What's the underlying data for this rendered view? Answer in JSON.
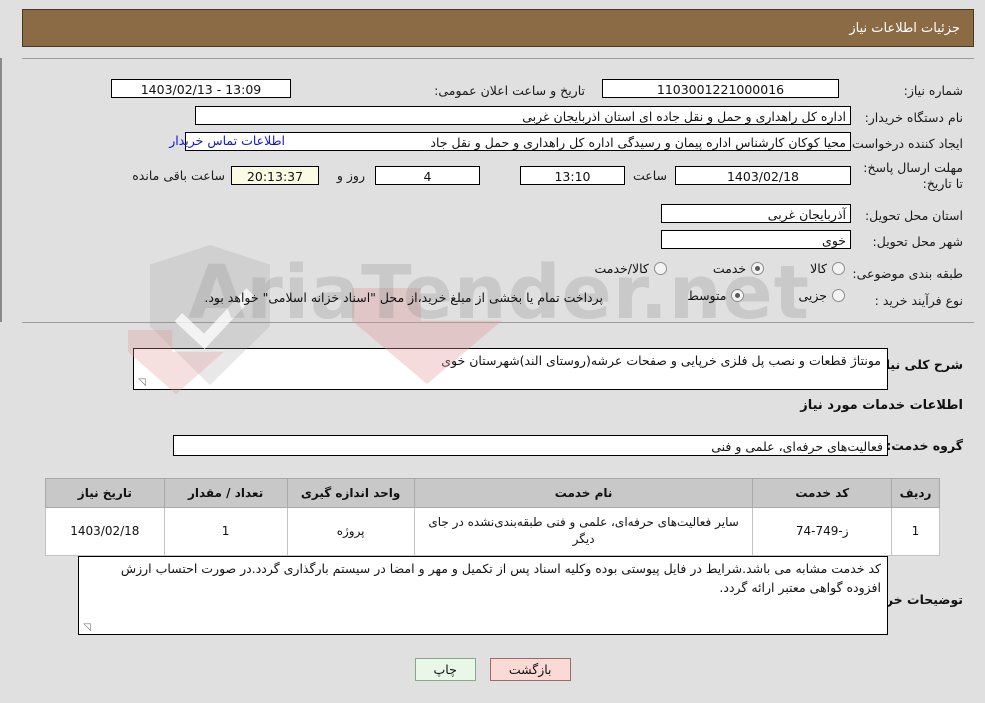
{
  "header": {
    "title": "جزئیات اطلاعات نیاز"
  },
  "form": {
    "need_number_label": "شماره نیاز:",
    "need_number_value": "1103001221000016",
    "announce_label": "تاریخ و ساعت اعلان عمومی:",
    "announce_value": "13:09 - 1403/02/13",
    "buyer_org_label": "نام دستگاه خریدار:",
    "buyer_org_value": "اداره کل راهداری و حمل و نقل جاده ای استان اذربایجان غربی",
    "requester_label": "ایجاد کننده درخواست:",
    "requester_value": "محیا کوکان کارشناس اداره پیمان و رسیدگی اداره کل راهداری و حمل و نقل جاد",
    "contact_link": "اطلاعات تماس خریدار",
    "deadline_label": "مهلت ارسال پاسخ: تا تاریخ:",
    "deadline_date": "1403/02/18",
    "hour_label": "ساعت",
    "deadline_time": "13:10",
    "remaining_days": "4",
    "days_and_label": "روز و",
    "remaining_time": "20:13:37",
    "remaining_suffix": "ساعت باقی مانده",
    "province_label": "استان محل تحویل:",
    "province_value": "آذربایجان غربی",
    "city_label": "شهر محل تحویل:",
    "city_value": "خوی",
    "category_label": "طبقه بندی موضوعی:",
    "category_options": [
      {
        "label": "کالا",
        "selected": false
      },
      {
        "label": "خدمت",
        "selected": true
      },
      {
        "label": "کالا/خدمت",
        "selected": false
      }
    ],
    "process_label": "نوع فرآیند خرید :",
    "process_options": [
      {
        "label": "جزیی",
        "selected": false
      },
      {
        "label": "متوسط",
        "selected": true
      }
    ],
    "payment_note": "پرداخت تمام یا بخشی از مبلغ خرید،از محل \"اسناد خزانه اسلامی\" خواهد بود."
  },
  "description": {
    "label": "شرح کلی نیاز:",
    "value": "مونتاژ قطعات و نصب پل فلزی خرپایی و صفحات عرشه(روستای الند)شهرستان خوی"
  },
  "services": {
    "heading": "اطلاعات خدمات مورد نیاز",
    "group_label": "گروه خدمت:",
    "group_value": "فعالیت‌های حرفه‌ای، علمی و فنی",
    "columns": [
      "ردیف",
      "کد خدمت",
      "نام خدمت",
      "واحد اندازه گیری",
      "تعداد / مقدار",
      "تاریخ نیاز"
    ],
    "rows": [
      {
        "index": "1",
        "code": "ز-749-74",
        "name": "سایر فعالیت‌های حرفه‌ای، علمی و فنی طبقه‌بندی‌نشده در جای دیگر",
        "unit": "پروژه",
        "qty": "1",
        "date": "1403/02/18"
      }
    ]
  },
  "buyer_notes": {
    "label": "توضیحات خریدار:",
    "value": "کد خدمت مشابه می باشد.شرایط در فایل پیوستی بوده وکلیه اسناد پس از تکمیل و مهر و امضا در سیستم بارگذاری گردد.در صورت احتساب ارزش افزوده گواهی معتبر ارائه گردد."
  },
  "buttons": {
    "print": "چاپ",
    "back": "بازگشت"
  },
  "watermark": {
    "text": "AriaTender.net"
  },
  "colors": {
    "header_bg": "#8a6b43",
    "link": "#1414d2",
    "page_bg": "#e0e0e0",
    "table_header_bg": "#c8c8c8",
    "print_btn_bg": "#e9f7e9",
    "back_btn_bg": "#fbd9d5",
    "countdown_bg": "#fbfbe3"
  }
}
